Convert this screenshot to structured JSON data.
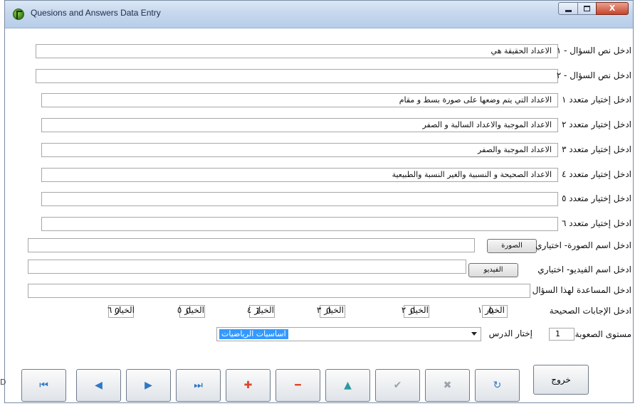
{
  "window": {
    "title": "Quesions and Answers Data Entry",
    "min_glyph": "",
    "max_glyph": "",
    "close_glyph": "X"
  },
  "form": {
    "q1_label": "ادخل نص السؤال - ١",
    "q1_value": "الاعداد الحقيقة هي",
    "q2_label": "ادخل نص السؤال - ٢",
    "q2_value": "",
    "c1_label": "ادخل إختيار متعدد ١",
    "c1_value": "الاعداد التي يتم وضعها على صورة بسط و مقام",
    "c2_label": "ادخل إختيار متعدد ٢",
    "c2_value": "الاعداد الموجبة والاعداد السالبة و الصفر",
    "c3_label": "ادخل إختيار متعدد ٣",
    "c3_value": "الاعداد الموجبة والصفر",
    "c4_label": "ادخل إختيار متعدد ٤",
    "c4_value": "الاعداد الصحيحة و النسبية والغير النسبة والطبيعية",
    "c5_label": "ادخل إختيار متعدد ٥",
    "c5_value": "",
    "c6_label": "ادخل إختيار متعدد ٦",
    "c6_value": "",
    "image_label": "ادخل اسم الصورة- اختياري",
    "image_value": "",
    "image_button": "الصورة",
    "video_label": "ادخل اسم الفيديو- اختياري",
    "video_value": "",
    "video_button": "الفيديو",
    "help_label": "ادخل المساعدة لهذا السؤال",
    "help_value": ""
  },
  "answers": {
    "label": "ادخل الإجابات الصحيحة",
    "opt1_label": "الخيار ١",
    "opt1_value": "0",
    "opt2_label": "الخيار ٢",
    "opt2_value": "0",
    "opt3_label": "الخيار ٣",
    "opt3_value": "0",
    "opt4_label": "الخيار ٤",
    "opt4_value": "1",
    "opt5_label": "الخيار ٥",
    "opt5_value": "0",
    "opt6_label": "الخيار ٦",
    "opt6_value": "0"
  },
  "difficulty": {
    "label": "مستوى الصعوبة",
    "value": "1",
    "lesson_label": "إختار الدرس",
    "lesson_value": "اساسيات الرياضيات"
  },
  "toolbar": {
    "first_glyph": "⏮",
    "prev_glyph": "◀",
    "next_glyph": "▶",
    "last_glyph": "⏭",
    "add_glyph": "✚",
    "delete_glyph": "━",
    "up_glyph": "▲",
    "confirm_glyph": "✔",
    "cancel_glyph": "✖",
    "refresh_glyph": "↻",
    "exit_label": "خروج"
  },
  "colors": {
    "accent_blue": "#3399ff",
    "nav_blue": "#2f78c4",
    "add_red": "#e0442a"
  },
  "edge_text": "D"
}
